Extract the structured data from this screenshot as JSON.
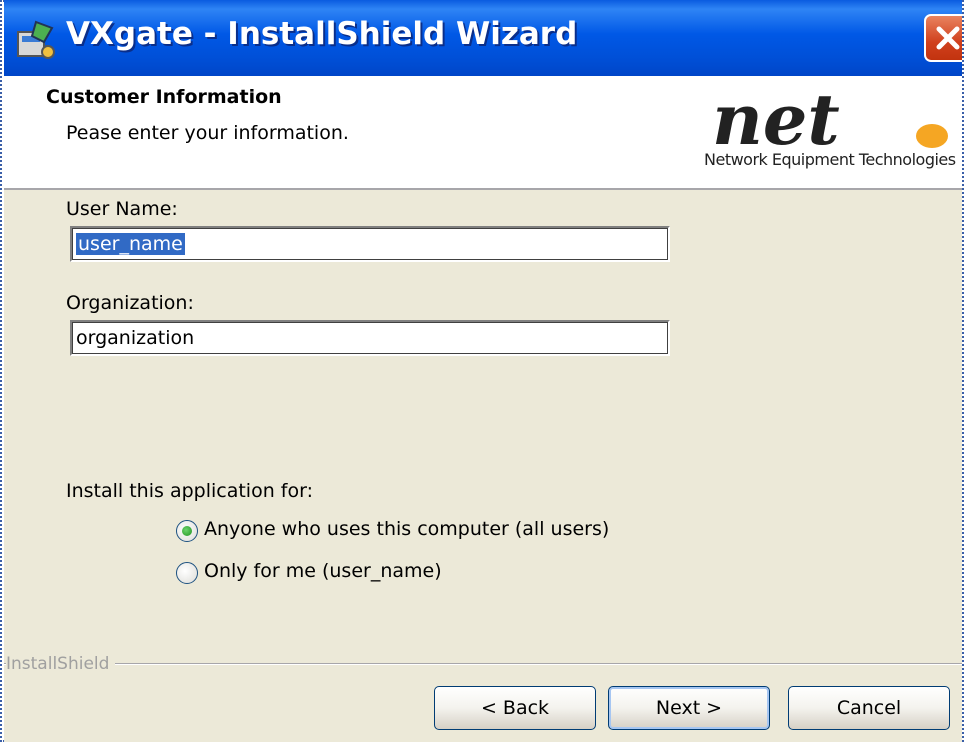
{
  "window": {
    "title": "VXgate - InstallShield Wizard",
    "title_icon": "installer-icon",
    "close_icon": "close-icon"
  },
  "header": {
    "title": "Customer Information",
    "subtitle": "Pease enter your information.",
    "logo_text": "net",
    "logo_tagline": "Network Equipment Technologies"
  },
  "form": {
    "user_name_label": "User Name:",
    "user_name_value": "user_name",
    "organization_label": "Organization:",
    "organization_value": "organization",
    "install_for_label": "Install this application for:",
    "options": [
      {
        "label": "Anyone who uses this computer (all users)",
        "selected": true
      },
      {
        "label": "Only for me (user_name)",
        "selected": false
      }
    ]
  },
  "footer": {
    "brand": "InstallShield",
    "back_label": "< Back",
    "next_label": "Next >",
    "cancel_label": "Cancel"
  },
  "colors": {
    "titlebar": "#0058e6",
    "dialog_bg": "#ece9d8",
    "selection": "#316ac5",
    "close_button": "#d0401d",
    "logo_dot": "#f5a623"
  }
}
